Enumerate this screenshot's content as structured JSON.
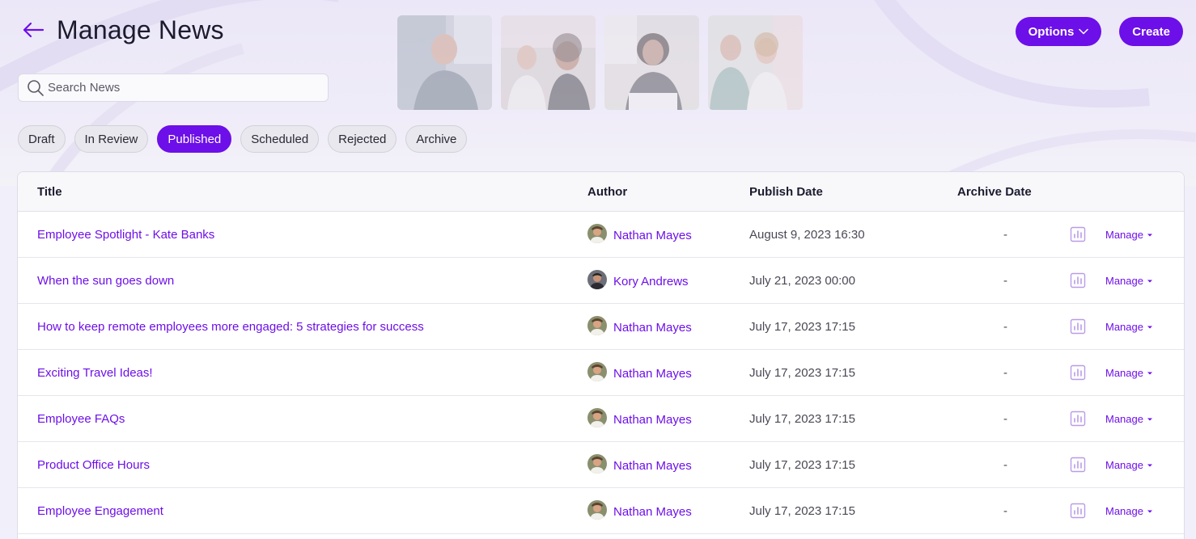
{
  "page": {
    "title": "Manage News",
    "accent_color": "#6d0fe8"
  },
  "icons": {
    "back": "arrow-left-icon",
    "search": "search-icon",
    "options_chevron": "chevron-down-icon",
    "stats": "bar-chart-icon",
    "manage_caret": "caret-down-icon"
  },
  "search": {
    "placeholder": "Search News",
    "value": ""
  },
  "actions": {
    "options_label": "Options",
    "create_label": "Create"
  },
  "tabs": [
    {
      "label": "Draft",
      "active": false
    },
    {
      "label": "In Review",
      "active": false
    },
    {
      "label": "Published",
      "active": true
    },
    {
      "label": "Scheduled",
      "active": false
    },
    {
      "label": "Rejected",
      "active": false
    },
    {
      "label": "Archive",
      "active": false
    }
  ],
  "table": {
    "columns": {
      "title": "Title",
      "author": "Author",
      "publish_date": "Publish Date",
      "archive_date": "Archive Date"
    },
    "rows": [
      {
        "title": "Employee Spotlight - Kate Banks",
        "author": "Nathan Mayes",
        "publish_date": "August 9, 2023 16:30",
        "archive_date": "-",
        "manage": "Manage"
      },
      {
        "title": "When the sun goes down",
        "author": "Kory Andrews",
        "publish_date": "July 21, 2023 00:00",
        "archive_date": "-",
        "manage": "Manage"
      },
      {
        "title": "How to keep remote employees more engaged: 5 strategies for success",
        "author": "Nathan Mayes",
        "publish_date": "July 17, 2023 17:15",
        "archive_date": "-",
        "manage": "Manage"
      },
      {
        "title": "Exciting Travel Ideas!",
        "author": "Nathan Mayes",
        "publish_date": "July 17, 2023 17:15",
        "archive_date": "-",
        "manage": "Manage"
      },
      {
        "title": "Employee FAQs",
        "author": "Nathan Mayes",
        "publish_date": "July 17, 2023 17:15",
        "archive_date": "-",
        "manage": "Manage"
      },
      {
        "title": "Product Office Hours",
        "author": "Nathan Mayes",
        "publish_date": "July 17, 2023 17:15",
        "archive_date": "-",
        "manage": "Manage"
      },
      {
        "title": "Employee Engagement",
        "author": "Nathan Mayes",
        "publish_date": "July 17, 2023 17:15",
        "archive_date": "-",
        "manage": "Manage"
      }
    ]
  }
}
